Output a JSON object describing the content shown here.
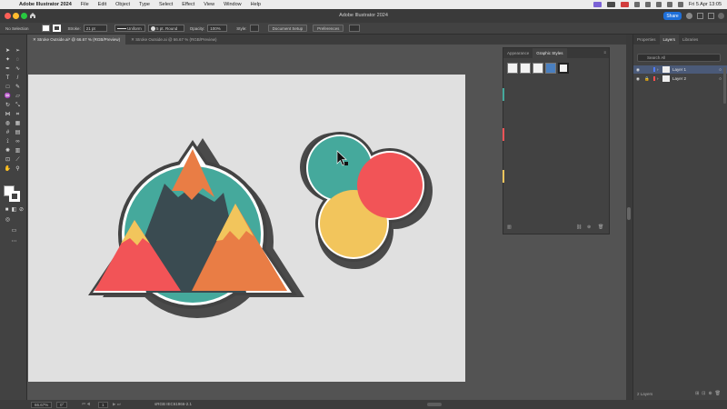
{
  "menubar": {
    "apple_glyph": "",
    "app_name": "Adobe Illustrator 2024",
    "menus": [
      "File",
      "Edit",
      "Object",
      "Type",
      "Select",
      "Effect",
      "View",
      "Window",
      "Help"
    ],
    "clock": "Fri 5 Apr  13:05"
  },
  "window": {
    "title": "Adobe Illustrator 2024",
    "share_label": "Share"
  },
  "controlbar": {
    "selection": "No Selection",
    "stroke_label": "Stroke:",
    "stroke_value": "21 pt",
    "profile": "Uniform",
    "brush": "5 pt. Round",
    "opacity_label": "Opacity:",
    "opacity_value": "100%",
    "style_label": "Style:",
    "doc_setup": "Document Setup",
    "preferences": "Preferences"
  },
  "tabs": [
    {
      "label": "Stroke Outside.ai* @ 66.67 % (RGB/Preview)",
      "active": true
    },
    {
      "label": "Stroke Outside.ai @ 66.67 % (RGB/Preview)",
      "active": false
    }
  ],
  "graphic_styles_panel": {
    "tabs": [
      "Appearance",
      "Graphic Styles"
    ],
    "active_tab": "Graphic Styles",
    "swatch_count": 5
  },
  "right_dock": {
    "tabs": [
      "Properties",
      "Layers",
      "Libraries"
    ],
    "active_tab": "Layers",
    "search_placeholder": "Search All",
    "layers": [
      {
        "name": "Layer 1",
        "selected": true,
        "color": "#4f7bff"
      },
      {
        "name": "Layer 2",
        "selected": false,
        "color": "#ff4f4f"
      }
    ],
    "layer_count": "2 Layers"
  },
  "statusbar": {
    "zoom": "66.67%",
    "rotation": "0°",
    "artboard": "1",
    "color_profile": "sRGB IEC61966-2.1"
  },
  "colors": {
    "teal": "#45a99c",
    "orange": "#e97d45",
    "coral": "#f25457",
    "yellow": "#f2c55c",
    "slate": "#3a4b51",
    "outline": "#434343"
  },
  "icons": [
    "apple-icon",
    "home-icon",
    "cursor-icon",
    "eye-icon",
    "lock-icon",
    "search-icon"
  ]
}
